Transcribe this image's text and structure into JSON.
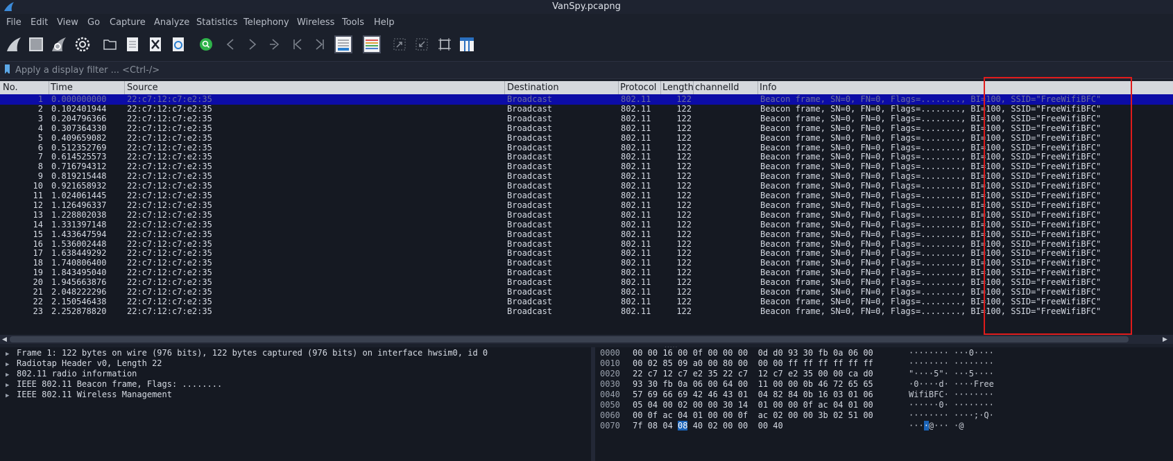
{
  "window": {
    "title": "VanSpy.pcapng",
    "icon": "wireshark-fin-icon"
  },
  "menu": [
    "File",
    "Edit",
    "View",
    "Go",
    "Capture",
    "Analyze",
    "Statistics",
    "Telephony",
    "Wireless",
    "Tools",
    "Help"
  ],
  "toolbar": {
    "icons": [
      "start-capture-icon",
      "stop-capture-icon",
      "restart-capture-icon",
      "capture-options-icon",
      "open-file-icon",
      "save-file-icon",
      "close-file-icon",
      "reload-file-icon",
      "find-packet-icon",
      "go-back-icon",
      "go-forward-icon",
      "go-to-packet-icon",
      "first-packet-icon",
      "last-packet-icon",
      "autoscroll-icon",
      "colorize-icon",
      "zoom-in-icon",
      "zoom-out-icon",
      "normal-size-icon",
      "resize-columns-icon"
    ]
  },
  "filter": {
    "placeholder": "Apply a display filter ... <Ctrl-/>"
  },
  "columns": [
    "No.",
    "Time",
    "Source",
    "Destination",
    "Protocol",
    "Length",
    "channelId",
    "Info"
  ],
  "packets": [
    {
      "no": "1",
      "time": "0.000000000",
      "src": "22:c7:12:c7:e2:35",
      "dst": "Broadcast",
      "proto": "802.11",
      "len": "122",
      "info": "Beacon frame, SN=0, FN=0, Flags=........, BI=100, SSID=\"FreeWifiBFC\""
    },
    {
      "no": "2",
      "time": "0.102401944",
      "src": "22:c7:12:c7:e2:35",
      "dst": "Broadcast",
      "proto": "802.11",
      "len": "122",
      "info": "Beacon frame, SN=0, FN=0, Flags=........, BI=100, SSID=\"FreeWifiBFC\""
    },
    {
      "no": "3",
      "time": "0.204796366",
      "src": "22:c7:12:c7:e2:35",
      "dst": "Broadcast",
      "proto": "802.11",
      "len": "122",
      "info": "Beacon frame, SN=0, FN=0, Flags=........, BI=100, SSID=\"FreeWifiBFC\""
    },
    {
      "no": "4",
      "time": "0.307364330",
      "src": "22:c7:12:c7:e2:35",
      "dst": "Broadcast",
      "proto": "802.11",
      "len": "122",
      "info": "Beacon frame, SN=0, FN=0, Flags=........, BI=100, SSID=\"FreeWifiBFC\""
    },
    {
      "no": "5",
      "time": "0.409659082",
      "src": "22:c7:12:c7:e2:35",
      "dst": "Broadcast",
      "proto": "802.11",
      "len": "122",
      "info": "Beacon frame, SN=0, FN=0, Flags=........, BI=100, SSID=\"FreeWifiBFC\""
    },
    {
      "no": "6",
      "time": "0.512352769",
      "src": "22:c7:12:c7:e2:35",
      "dst": "Broadcast",
      "proto": "802.11",
      "len": "122",
      "info": "Beacon frame, SN=0, FN=0, Flags=........, BI=100, SSID=\"FreeWifiBFC\""
    },
    {
      "no": "7",
      "time": "0.614525573",
      "src": "22:c7:12:c7:e2:35",
      "dst": "Broadcast",
      "proto": "802.11",
      "len": "122",
      "info": "Beacon frame, SN=0, FN=0, Flags=........, BI=100, SSID=\"FreeWifiBFC\""
    },
    {
      "no": "8",
      "time": "0.716794312",
      "src": "22:c7:12:c7:e2:35",
      "dst": "Broadcast",
      "proto": "802.11",
      "len": "122",
      "info": "Beacon frame, SN=0, FN=0, Flags=........, BI=100, SSID=\"FreeWifiBFC\""
    },
    {
      "no": "9",
      "time": "0.819215448",
      "src": "22:c7:12:c7:e2:35",
      "dst": "Broadcast",
      "proto": "802.11",
      "len": "122",
      "info": "Beacon frame, SN=0, FN=0, Flags=........, BI=100, SSID=\"FreeWifiBFC\""
    },
    {
      "no": "10",
      "time": "0.921658932",
      "src": "22:c7:12:c7:e2:35",
      "dst": "Broadcast",
      "proto": "802.11",
      "len": "122",
      "info": "Beacon frame, SN=0, FN=0, Flags=........, BI=100, SSID=\"FreeWifiBFC\""
    },
    {
      "no": "11",
      "time": "1.024061445",
      "src": "22:c7:12:c7:e2:35",
      "dst": "Broadcast",
      "proto": "802.11",
      "len": "122",
      "info": "Beacon frame, SN=0, FN=0, Flags=........, BI=100, SSID=\"FreeWifiBFC\""
    },
    {
      "no": "12",
      "time": "1.126496337",
      "src": "22:c7:12:c7:e2:35",
      "dst": "Broadcast",
      "proto": "802.11",
      "len": "122",
      "info": "Beacon frame, SN=0, FN=0, Flags=........, BI=100, SSID=\"FreeWifiBFC\""
    },
    {
      "no": "13",
      "time": "1.228802038",
      "src": "22:c7:12:c7:e2:35",
      "dst": "Broadcast",
      "proto": "802.11",
      "len": "122",
      "info": "Beacon frame, SN=0, FN=0, Flags=........, BI=100, SSID=\"FreeWifiBFC\""
    },
    {
      "no": "14",
      "time": "1.331397148",
      "src": "22:c7:12:c7:e2:35",
      "dst": "Broadcast",
      "proto": "802.11",
      "len": "122",
      "info": "Beacon frame, SN=0, FN=0, Flags=........, BI=100, SSID=\"FreeWifiBFC\""
    },
    {
      "no": "15",
      "time": "1.433647594",
      "src": "22:c7:12:c7:e2:35",
      "dst": "Broadcast",
      "proto": "802.11",
      "len": "122",
      "info": "Beacon frame, SN=0, FN=0, Flags=........, BI=100, SSID=\"FreeWifiBFC\""
    },
    {
      "no": "16",
      "time": "1.536002448",
      "src": "22:c7:12:c7:e2:35",
      "dst": "Broadcast",
      "proto": "802.11",
      "len": "122",
      "info": "Beacon frame, SN=0, FN=0, Flags=........, BI=100, SSID=\"FreeWifiBFC\""
    },
    {
      "no": "17",
      "time": "1.638449292",
      "src": "22:c7:12:c7:e2:35",
      "dst": "Broadcast",
      "proto": "802.11",
      "len": "122",
      "info": "Beacon frame, SN=0, FN=0, Flags=........, BI=100, SSID=\"FreeWifiBFC\""
    },
    {
      "no": "18",
      "time": "1.740806400",
      "src": "22:c7:12:c7:e2:35",
      "dst": "Broadcast",
      "proto": "802.11",
      "len": "122",
      "info": "Beacon frame, SN=0, FN=0, Flags=........, BI=100, SSID=\"FreeWifiBFC\""
    },
    {
      "no": "19",
      "time": "1.843495040",
      "src": "22:c7:12:c7:e2:35",
      "dst": "Broadcast",
      "proto": "802.11",
      "len": "122",
      "info": "Beacon frame, SN=0, FN=0, Flags=........, BI=100, SSID=\"FreeWifiBFC\""
    },
    {
      "no": "20",
      "time": "1.945663876",
      "src": "22:c7:12:c7:e2:35",
      "dst": "Broadcast",
      "proto": "802.11",
      "len": "122",
      "info": "Beacon frame, SN=0, FN=0, Flags=........, BI=100, SSID=\"FreeWifiBFC\""
    },
    {
      "no": "21",
      "time": "2.048222296",
      "src": "22:c7:12:c7:e2:35",
      "dst": "Broadcast",
      "proto": "802.11",
      "len": "122",
      "info": "Beacon frame, SN=0, FN=0, Flags=........, BI=100, SSID=\"FreeWifiBFC\""
    },
    {
      "no": "22",
      "time": "2.150546438",
      "src": "22:c7:12:c7:e2:35",
      "dst": "Broadcast",
      "proto": "802.11",
      "len": "122",
      "info": "Beacon frame, SN=0, FN=0, Flags=........, BI=100, SSID=\"FreeWifiBFC\""
    },
    {
      "no": "23",
      "time": "2.252878820",
      "src": "22:c7:12:c7:e2:35",
      "dst": "Broadcast",
      "proto": "802.11",
      "len": "122",
      "info": "Beacon frame, SN=0, FN=0, Flags=........, BI=100, SSID=\"FreeWifiBFC\""
    }
  ],
  "selected_row": 1,
  "details": [
    "Frame 1: 122 bytes on wire (976 bits), 122 bytes captured (976 bits) on interface hwsim0, id 0",
    "Radiotap Header v0, Length 22",
    "802.11 radio information",
    "IEEE 802.11 Beacon frame, Flags: ........",
    "IEEE 802.11 Wireless Management"
  ],
  "hex": [
    {
      "offset": "0000",
      "bytes": "00 00 16 00 0f 00 00 00  0d d0 93 30 fb 0a 06 00",
      "ascii": "········ ···0····"
    },
    {
      "offset": "0010",
      "bytes": "00 02 85 09 a0 00 80 00  00 00 ff ff ff ff ff ff",
      "ascii": "········ ········"
    },
    {
      "offset": "0020",
      "bytes": "22 c7 12 c7 e2 35 22 c7  12 c7 e2 35 00 00 ca d0",
      "ascii": "\"····5\"· ···5····"
    },
    {
      "offset": "0030",
      "bytes": "93 30 fb 0a 06 00 64 00  11 00 00 0b 46 72 65 65",
      "ascii": "·0····d· ····Free"
    },
    {
      "offset": "0040",
      "bytes": "57 69 66 69 42 46 43 01  04 82 84 0b 16 03 01 06",
      "ascii": "WifiBFC· ········"
    },
    {
      "offset": "0050",
      "bytes": "05 04 00 02 00 00 30 14  01 00 00 0f ac 04 01 00",
      "ascii": "······0· ········"
    },
    {
      "offset": "0060",
      "bytes": "00 0f ac 04 01 00 00 0f  ac 02 00 00 3b 02 51 00",
      "ascii": "········ ····;·Q·"
    },
    {
      "offset": "0070",
      "bytes_pre": "7f 08 04 ",
      "bytes_hl": "08",
      "bytes_post": " 40 02 00 00  00 40",
      "ascii_pre": "···",
      "ascii_hl": "·",
      "ascii_post": "@··· ·@"
    }
  ],
  "colors": {
    "selected_row": "#0c0ca6",
    "highlight_byte": "#1a63b8",
    "annotation_box": "#e01b1b",
    "filter_flag": "#5ca8e8"
  }
}
